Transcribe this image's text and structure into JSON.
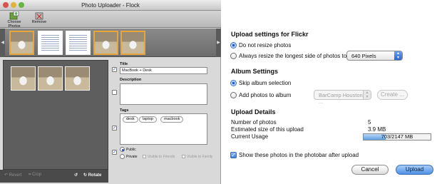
{
  "window": {
    "title": "Photo Uploader - Flock"
  },
  "toolbar": {
    "choose_label": "Choose Photos",
    "remove_label": "Remove"
  },
  "canvas_bar": {
    "revert_label": "Revert",
    "crop_label": "Crop",
    "rotate_label": "Rotate"
  },
  "form": {
    "title_label": "Title",
    "title_value": "MacBook + Desk",
    "description_label": "Description",
    "description_value": "",
    "tags_label": "Tags",
    "tags": [
      "desk",
      "laptop",
      "macbook"
    ],
    "privacy": {
      "public_label": "Public",
      "private_label": "Private",
      "friends_label": "Visible to Friends",
      "family_label": "Visible to Family",
      "selected": "public"
    }
  },
  "settings": {
    "heading_upload": "Upload settings for Flickr",
    "opt_no_resize": "Do not resize photos",
    "opt_resize": "Always resize the longest side of photos to",
    "resize_value": "640 Pixels",
    "heading_album": "Album Settings",
    "opt_skip_album": "Skip album selection",
    "opt_add_album": "Add photos to album",
    "album_value": "BarCamp Houston ...",
    "create_label": "Create ...",
    "heading_details": "Upload Details",
    "num_photos_label": "Number of photos",
    "num_photos_value": "5",
    "est_size_label": "Estimated size of this upload",
    "est_size_value": "3.9 MB",
    "usage_label": "Current Usage",
    "usage_value": "703/2147 MB",
    "usage_fraction": 0.327,
    "show_photobar_label": "Show these photos in the photobar after upload",
    "cancel_label": "Cancel",
    "upload_label": "Upload"
  },
  "colors": {
    "accent": "#3b6fb8",
    "selection": "#e8a63a",
    "dark_panel": "#5e5e5e"
  }
}
